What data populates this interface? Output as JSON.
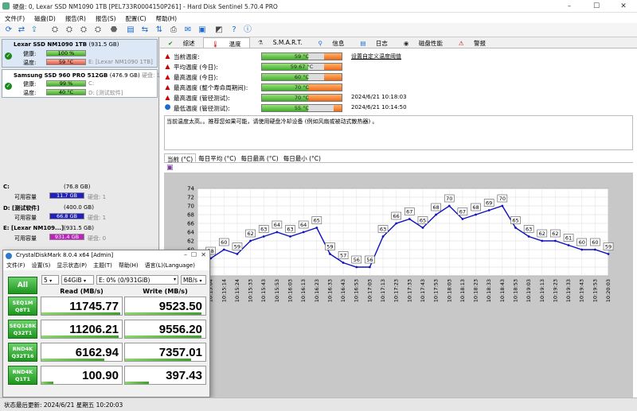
{
  "window": {
    "title": "硬盘:  0, Lexar SSD NM1090 1TB [PEL733R0004150P261]  -  Hard Disk Sentinel 5.70.4 PRO"
  },
  "menu": [
    "文件(F)",
    "磁盘(D)",
    "报告(R)",
    "报告(S)",
    "配置(C)",
    "帮助(H)"
  ],
  "disks": [
    {
      "name": "Lexar SSD NM1090 1TB",
      "size": "(931.5 GB)",
      "health_label": "健康:",
      "health": "100 %",
      "health_pct": 100,
      "temp_label": "温度:",
      "temp": "59 °C",
      "drive": "E: [Lexar NM1090 1TB]"
    },
    {
      "name": "Samsung SSD 960 PRO 512GB",
      "size": "(476.9 GB)",
      "extra": "硬盘: 1",
      "health_label": "健康:",
      "health": "99 %",
      "health_pct": 99,
      "temp_label": "温度:",
      "temp": "40 °C",
      "drive_c": "C:",
      "drive": "D: [测试软件]"
    }
  ],
  "volumes": [
    {
      "name": "C:",
      "size": "(76.8 GB)",
      "free_label": "可用容量",
      "free": "11.7 GB",
      "disk": "硬盘: 1",
      "color": "#2020c0"
    },
    {
      "name": "D: [测试软件]",
      "size": "(400.0 GB)",
      "free_label": "可用容量",
      "free": "66.8 GB",
      "disk": "硬盘: 1",
      "color": "#2020c0"
    },
    {
      "name": "E: [Lexar NM109...]",
      "size": "(931.5 GB)",
      "free_label": "可用容量",
      "free": "931.4 GB",
      "disk": "硬盘: 0",
      "color": "#c020c0"
    }
  ],
  "tabs": [
    "综述",
    "温度",
    "S.M.A.R.T.",
    "信息",
    "日志",
    "磁盘性能",
    "警报"
  ],
  "temps": [
    {
      "label": "当前温度:",
      "value": "59 °C",
      "warn": true
    },
    {
      "label": "平均温度 (今日):",
      "value": "59.67 °C",
      "warn": true
    },
    {
      "label": "最高温度 (今日):",
      "value": "60 °C",
      "warn": true
    },
    {
      "label": "最高温度 (整个寿命周期间):",
      "value": "70 °C",
      "warn": true
    },
    {
      "label": "最高温度 (管径测试):",
      "value": "70 °C",
      "date": "2024/6/21 10:18:03",
      "warn": true
    },
    {
      "label": "最低温度 (管径测试):",
      "value": "55 °C",
      "date": "2024/6/21 10:14:50",
      "warn": false
    }
  ],
  "threshold_link": "设置自定义温度阈值",
  "message": "当前温度太高。。推荐您如果可能，请使用硬盘冷却设备 (例如风扇或被动式散热器) 。",
  "chart_tabs": [
    "当前 (°C)",
    "每日平均 (°C)",
    "每日最高 (°C)",
    "每日最小 (°C)"
  ],
  "chart_data": {
    "type": "line",
    "x": [
      "10:15:04",
      "10:15:14",
      "10:15:24",
      "10:15:33",
      "10:15:43",
      "10:15:53",
      "10:16:03",
      "10:16:13",
      "10:16:23",
      "10:16:33",
      "10:16:43",
      "10:16:53",
      "10:17:03",
      "10:17:13",
      "10:17:23",
      "10:17:33",
      "10:17:43",
      "10:17:53",
      "10:18:03",
      "10:18:13",
      "10:18:23",
      "10:18:33",
      "10:18:43",
      "10:18:53",
      "10:19:03",
      "10:19:13",
      "10:19:23",
      "10:19:33",
      "10:19:43",
      "10:19:53",
      "10:20:03"
    ],
    "values": [
      55,
      58,
      60,
      59,
      62,
      63,
      64,
      63,
      64,
      65,
      59,
      57,
      56,
      56,
      63,
      66,
      67,
      65,
      68,
      70,
      67,
      68,
      69,
      70,
      65,
      63,
      62,
      62,
      61,
      60,
      60,
      59
    ],
    "ylim": [
      54,
      74
    ],
    "yticks": [
      54,
      56,
      58,
      60,
      62,
      64,
      66,
      68,
      70,
      72,
      74
    ],
    "color": "#1010c0",
    "grid": true
  },
  "cdm": {
    "title": "CrystalDiskMark 8.0.4 x64 [Admin]",
    "menu": [
      "文件(F)",
      "设置(S)",
      "显示状态(P)",
      "主题(T)",
      "帮助(H)",
      "语言(L)(Language)"
    ],
    "all": "All",
    "count": "5",
    "size": "64GiB",
    "drive": "E: 0% (0/931GiB)",
    "unit": "MB/s",
    "read_header": "Read (MB/s)",
    "write_header": "Write (MB/s)",
    "tests": [
      {
        "l1": "SEQ1M",
        "l2": "Q8T1",
        "read": "11745.77",
        "write": "9523.50",
        "rf": 0.98,
        "wf": 0.95
      },
      {
        "l1": "SEQ128K",
        "l2": "Q32T1",
        "read": "11206.21",
        "write": "9556.20",
        "rf": 0.96,
        "wf": 0.95
      },
      {
        "l1": "RND4K",
        "l2": "Q32T16",
        "read": "6162.94",
        "write": "7357.01",
        "rf": 0.78,
        "wf": 0.82
      },
      {
        "l1": "RND4K",
        "l2": "Q1T1",
        "read": "100.90",
        "write": "397.43",
        "rf": 0.15,
        "wf": 0.3
      }
    ]
  },
  "status": "状态最后更新:     2024/6/21 星期五 10:20:03"
}
